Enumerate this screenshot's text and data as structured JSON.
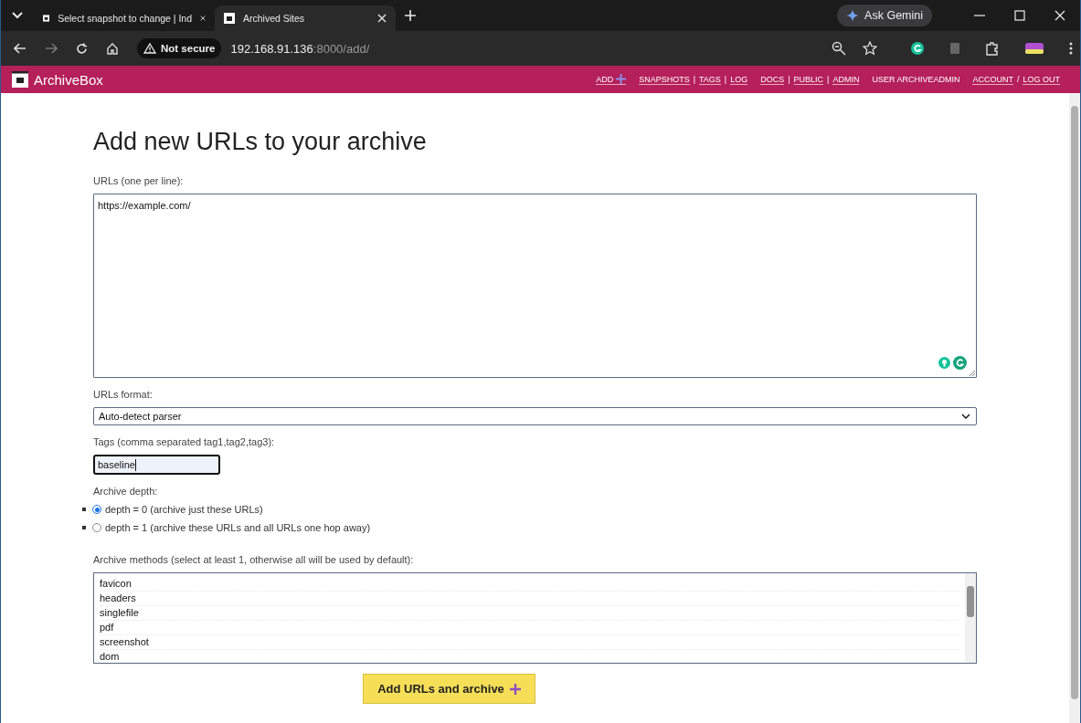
{
  "browser": {
    "tabs": [
      {
        "title": "Select snapshot to change | Ind",
        "selected": false
      },
      {
        "title": "Archived Sites",
        "selected": true
      }
    ],
    "ask_button": "Ask Gemini",
    "security": "Not secure",
    "url_host": "192.168.91.136",
    "url_rest": ":8000/add/"
  },
  "header": {
    "brand": "ArchiveBox",
    "nav": [
      {
        "kind": "add",
        "links": [
          "ADD"
        ]
      },
      {
        "kind": "links",
        "links": [
          "SNAPSHOTS",
          "TAGS",
          "LOG"
        ],
        "separator": "|"
      },
      {
        "kind": "links",
        "links": [
          "DOCS",
          "PUBLIC",
          "ADMIN"
        ],
        "separator": "|"
      },
      {
        "kind": "text",
        "links": [
          "USER ARCHIVEADMIN"
        ]
      },
      {
        "kind": "links",
        "links": [
          "ACCOUNT",
          "LOG OUT"
        ],
        "separator": "/"
      }
    ]
  },
  "form": {
    "title": "Add new URLs to your archive",
    "urls_label": "URLs (one per line):",
    "urls_value": "https://example.com/",
    "format_label": "URLs format:",
    "format_value": "Auto-detect parser",
    "tags_label": "Tags (comma separated tag1,tag2,tag3):",
    "tags_value": "baseline",
    "depth_label": "Archive depth:",
    "depth_options": [
      {
        "label": "depth = 0 (archive just these URLs)",
        "selected": true
      },
      {
        "label": "depth = 1 (archive these URLs and all URLs one hop away)",
        "selected": false
      }
    ],
    "methods_label": "Archive methods (select at least 1, otherwise all will be used by default):",
    "methods": [
      {
        "label": "favicon",
        "selected": false
      },
      {
        "label": "headers",
        "selected": false
      },
      {
        "label": "singlefile",
        "selected": false
      },
      {
        "label": "pdf",
        "selected": false
      },
      {
        "label": "screenshot",
        "selected": false
      },
      {
        "label": "dom",
        "selected": false
      }
    ],
    "submit": "Add URLs and archive"
  }
}
